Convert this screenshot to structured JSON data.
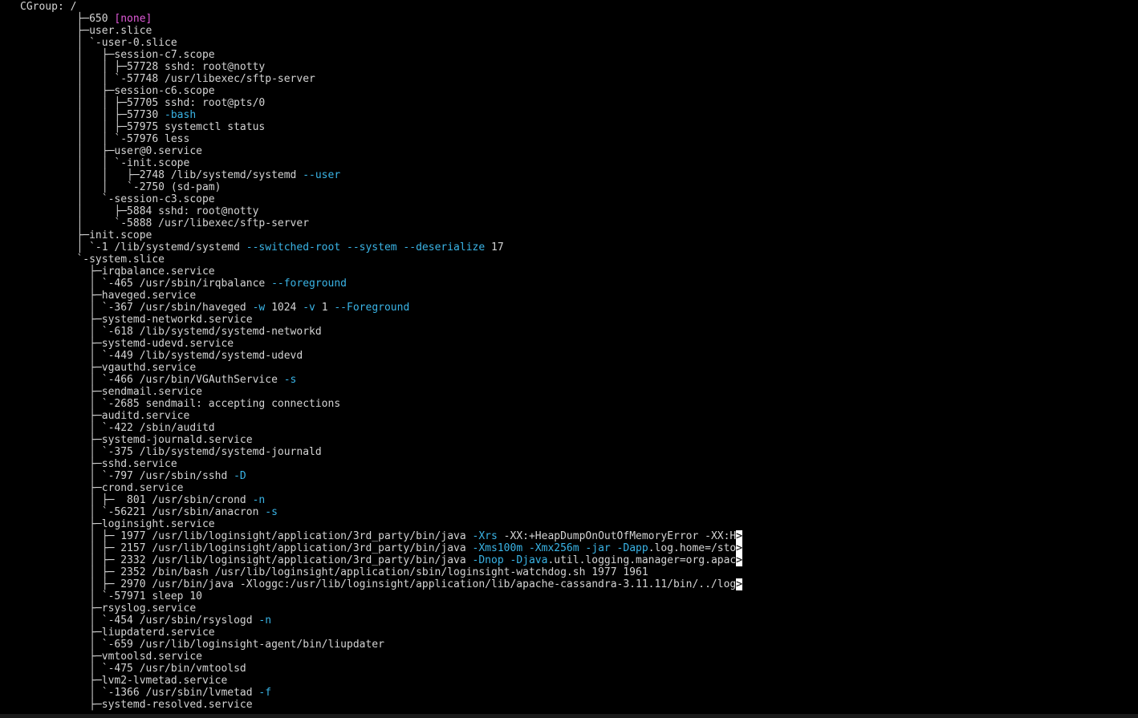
{
  "terminal": {
    "colors": {
      "background": "#000000",
      "text": "#d4d4d4",
      "option": "#3ab4e6",
      "none_tag": "#e05ad8",
      "cursor": "#ffffff"
    },
    "lines": [
      [
        [
          "t",
          "CGroup: /"
        ]
      ],
      [
        [
          "t",
          "         ├─650 "
        ],
        [
          "m",
          "[none]"
        ]
      ],
      [
        [
          "t",
          "         ├─user.slice"
        ]
      ],
      [
        [
          "t",
          "         │ `-user-0.slice"
        ]
      ],
      [
        [
          "t",
          "         │   ├─session-c7.scope"
        ]
      ],
      [
        [
          "t",
          "         │   │ ├─57728 sshd: root@notty"
        ]
      ],
      [
        [
          "t",
          "         │   │ `-57748 /usr/libexec/sftp-server"
        ]
      ],
      [
        [
          "t",
          "         │   ├─session-c6.scope"
        ]
      ],
      [
        [
          "t",
          "         │   │ ├─57705 sshd: root@pts/0"
        ]
      ],
      [
        [
          "t",
          "         │   │ ├─57730 "
        ],
        [
          "o",
          "-bash"
        ]
      ],
      [
        [
          "t",
          "         │   │ ├─57975 systemctl status"
        ]
      ],
      [
        [
          "t",
          "         │   │ `-57976 less"
        ]
      ],
      [
        [
          "t",
          "         │   ├─user@0.service"
        ]
      ],
      [
        [
          "t",
          "         │   │ `-init.scope"
        ]
      ],
      [
        [
          "t",
          "         │   │   ├─2748 /lib/systemd/systemd "
        ],
        [
          "o",
          "--user"
        ]
      ],
      [
        [
          "t",
          "         │   │   `-2750 (sd-pam)"
        ]
      ],
      [
        [
          "t",
          "         │   `-session-c3.scope"
        ]
      ],
      [
        [
          "t",
          "         │     ├─5884 sshd: root@notty"
        ]
      ],
      [
        [
          "t",
          "         │     `-5888 /usr/libexec/sftp-server"
        ]
      ],
      [
        [
          "t",
          "         ├─init.scope"
        ]
      ],
      [
        [
          "t",
          "         │ `-1 /lib/systemd/systemd "
        ],
        [
          "o",
          "--switched-root --system --deserialize"
        ],
        [
          "t",
          " 17"
        ]
      ],
      [
        [
          "t",
          "         `-system.slice"
        ]
      ],
      [
        [
          "t",
          "           ├─irqbalance.service"
        ]
      ],
      [
        [
          "t",
          "           │ `-465 /usr/sbin/irqbalance "
        ],
        [
          "o",
          "--foreground"
        ]
      ],
      [
        [
          "t",
          "           ├─haveged.service"
        ]
      ],
      [
        [
          "t",
          "           │ `-367 /usr/sbin/haveged "
        ],
        [
          "o",
          "-w"
        ],
        [
          "t",
          " 1024 "
        ],
        [
          "o",
          "-v"
        ],
        [
          "t",
          " 1 "
        ],
        [
          "o",
          "--Foreground"
        ]
      ],
      [
        [
          "t",
          "           ├─systemd-networkd.service"
        ]
      ],
      [
        [
          "t",
          "           │ `-618 /lib/systemd/systemd-networkd"
        ]
      ],
      [
        [
          "t",
          "           ├─systemd-udevd.service"
        ]
      ],
      [
        [
          "t",
          "           │ `-449 /lib/systemd/systemd-udevd"
        ]
      ],
      [
        [
          "t",
          "           ├─vgauthd.service"
        ]
      ],
      [
        [
          "t",
          "           │ `-466 /usr/bin/VGAuthService "
        ],
        [
          "o",
          "-s"
        ]
      ],
      [
        [
          "t",
          "           ├─sendmail.service"
        ]
      ],
      [
        [
          "t",
          "           │ `-2685 sendmail: accepting connections"
        ]
      ],
      [
        [
          "t",
          "           ├─auditd.service"
        ]
      ],
      [
        [
          "t",
          "           │ `-422 /sbin/auditd"
        ]
      ],
      [
        [
          "t",
          "           ├─systemd-journald.service"
        ]
      ],
      [
        [
          "t",
          "           │ `-375 /lib/systemd/systemd-journald"
        ]
      ],
      [
        [
          "t",
          "           ├─sshd.service"
        ]
      ],
      [
        [
          "t",
          "           │ `-797 /usr/sbin/sshd "
        ],
        [
          "o",
          "-D"
        ]
      ],
      [
        [
          "t",
          "           ├─crond.service"
        ]
      ],
      [
        [
          "t",
          "           │ ├─  801 /usr/sbin/crond "
        ],
        [
          "o",
          "-n"
        ]
      ],
      [
        [
          "t",
          "           │ `-56221 /usr/sbin/anacron "
        ],
        [
          "o",
          "-s"
        ]
      ],
      [
        [
          "t",
          "           ├─loginsight.service"
        ]
      ],
      [
        [
          "t",
          "           │ ├─ 1977 /usr/lib/loginsight/application/3rd_party/bin/java "
        ],
        [
          "o",
          "-Xrs"
        ],
        [
          "t",
          " -XX:+HeapDumpOnOutOfMemoryError -XX:H"
        ],
        [
          "c",
          ">"
        ]
      ],
      [
        [
          "t",
          "           │ ├─ 2157 /usr/lib/loginsight/application/3rd_party/bin/java "
        ],
        [
          "o",
          "-Xms100m -Xmx256m -jar -Dapp"
        ],
        [
          "t",
          ".log.home=/sto"
        ],
        [
          "c",
          ">"
        ]
      ],
      [
        [
          "t",
          "           │ ├─ 2332 /usr/lib/loginsight/application/3rd_party/bin/java "
        ],
        [
          "o",
          "-Dnop -Djava"
        ],
        [
          "t",
          ".util.logging.manager=org.apac"
        ],
        [
          "c",
          ">"
        ]
      ],
      [
        [
          "t",
          "           │ ├─ 2352 /bin/bash /usr/lib/loginsight/application/sbin/loginsight-watchdog.sh 1977 1961"
        ]
      ],
      [
        [
          "t",
          "           │ ├─ 2970 /usr/bin/java -Xloggc:/usr/lib/loginsight/application/lib/apache-cassandra-3.11.11/bin/../log"
        ],
        [
          "c",
          ">"
        ]
      ],
      [
        [
          "t",
          "           │ `-57971 sleep 10"
        ]
      ],
      [
        [
          "t",
          "           ├─rsyslog.service"
        ]
      ],
      [
        [
          "t",
          "           │ `-454 /usr/sbin/rsyslogd "
        ],
        [
          "o",
          "-n"
        ]
      ],
      [
        [
          "t",
          "           ├─liupdaterd.service"
        ]
      ],
      [
        [
          "t",
          "           │ `-659 /usr/lib/loginsight-agent/bin/liupdater"
        ]
      ],
      [
        [
          "t",
          "           ├─vmtoolsd.service"
        ]
      ],
      [
        [
          "t",
          "           │ `-475 /usr/bin/vmtoolsd"
        ]
      ],
      [
        [
          "t",
          "           ├─lvm2-lvmetad.service"
        ]
      ],
      [
        [
          "t",
          "           │ `-1366 /usr/sbin/lvmetad "
        ],
        [
          "o",
          "-f"
        ]
      ],
      [
        [
          "t",
          "           ├─systemd-resolved.service"
        ]
      ]
    ]
  }
}
